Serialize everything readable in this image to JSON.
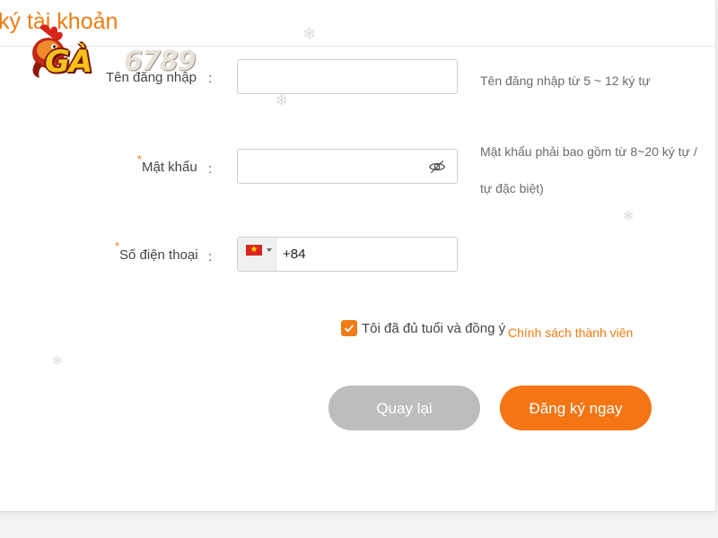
{
  "page": {
    "title": "ký tài khoản"
  },
  "logo": {
    "brand_text": "GÀ",
    "brand_number": "6789"
  },
  "form": {
    "username": {
      "label": "Tên đăng nhập",
      "colon": ":",
      "value": "",
      "placeholder": "",
      "hint": "Tên đăng nhập từ 5 ~ 12 ký tự"
    },
    "password": {
      "required_mark": "*",
      "label": "Mật khẩu",
      "colon": ":",
      "value": "",
      "placeholder": "",
      "toggle_icon": "eye-slash-icon",
      "hint_line1": "Mật khẩu phải bao gồm từ 8~20 ký tự /",
      "hint_line2": "tự đặc biệt)"
    },
    "phone": {
      "required_mark": "*",
      "label": "Số điện thoại",
      "colon": ":",
      "country_flag": "vietnam-flag-icon",
      "dial_code": "+84"
    },
    "agreement": {
      "checked": true,
      "text": "Tôi đã đủ tuổi và đồng ý",
      "link_text": "Chính sách thành viên"
    }
  },
  "buttons": {
    "back_label": "Quay lại",
    "register_label": "Đăng ký ngay"
  },
  "colors": {
    "accent": "#f07c13",
    "button_primary": "#f47514",
    "button_secondary": "#bdbdbd"
  }
}
